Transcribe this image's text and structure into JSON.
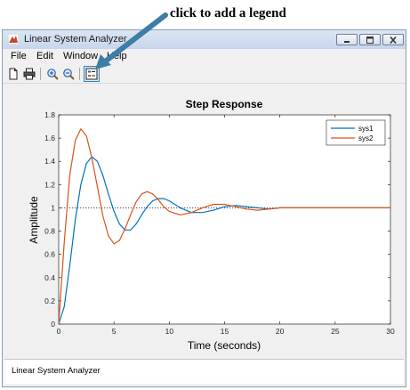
{
  "annotation": {
    "text": "click to add a legend"
  },
  "window": {
    "title": "Linear System Analyzer"
  },
  "menu": {
    "items": [
      {
        "label": "File"
      },
      {
        "label": "Edit"
      },
      {
        "label": "Window"
      },
      {
        "label": "Help"
      }
    ]
  },
  "toolbar": {
    "buttons": [
      "new-file-icon",
      "print-icon",
      "zoom-in-icon",
      "zoom-out-icon",
      "legend-icon"
    ],
    "active": "legend-icon"
  },
  "chart_data": {
    "type": "line",
    "title": "Step Response",
    "xlabel": "Time (seconds)",
    "ylabel": "Amplitude",
    "xlim": [
      0,
      30
    ],
    "ylim": [
      0,
      1.8
    ],
    "xticks": [
      "0",
      "5",
      "10",
      "15",
      "20",
      "25",
      "30"
    ],
    "yticks": [
      "0",
      "0.2",
      "0.4",
      "0.6",
      "0.8",
      "1",
      "1.2",
      "1.4",
      "1.6",
      "1.8"
    ],
    "reference_line": 1,
    "legend_position": "top-right",
    "series": [
      {
        "name": "sys1",
        "color": "#0072bd",
        "x": [
          0,
          0.5,
          1,
          1.5,
          2,
          2.5,
          3,
          3.5,
          4,
          4.5,
          5,
          5.5,
          6,
          6.5,
          7,
          7.5,
          8,
          8.5,
          9,
          9.5,
          10,
          11,
          12,
          13,
          14,
          15,
          16,
          17,
          18,
          19,
          20,
          22,
          24,
          26,
          28,
          30
        ],
        "y": [
          0,
          0.15,
          0.5,
          0.9,
          1.2,
          1.38,
          1.44,
          1.4,
          1.28,
          1.12,
          0.97,
          0.86,
          0.81,
          0.81,
          0.86,
          0.94,
          1.01,
          1.06,
          1.08,
          1.08,
          1.06,
          1.0,
          0.96,
          0.96,
          0.98,
          1.01,
          1.02,
          1.01,
          1.0,
          0.99,
          1.0,
          1.0,
          1.0,
          1.0,
          1.0,
          1.0
        ]
      },
      {
        "name": "sys2",
        "color": "#d95319",
        "x": [
          0,
          0.5,
          1,
          1.5,
          2,
          2.5,
          3,
          3.5,
          4,
          4.5,
          5,
          5.5,
          6,
          6.5,
          7,
          7.5,
          8,
          8.5,
          9,
          9.5,
          10,
          11,
          12,
          13,
          14,
          15,
          16,
          17,
          18,
          19,
          20,
          22,
          24,
          26,
          28,
          30
        ],
        "y": [
          0,
          0.7,
          1.28,
          1.58,
          1.68,
          1.62,
          1.43,
          1.18,
          0.93,
          0.76,
          0.69,
          0.72,
          0.82,
          0.94,
          1.05,
          1.12,
          1.14,
          1.12,
          1.07,
          1.01,
          0.97,
          0.94,
          0.96,
          1.0,
          1.03,
          1.03,
          1.01,
          0.99,
          0.98,
          0.99,
          1.0,
          1.0,
          1.0,
          1.0,
          1.0,
          1.0
        ]
      }
    ]
  },
  "status": {
    "text": "Linear System Analyzer"
  }
}
